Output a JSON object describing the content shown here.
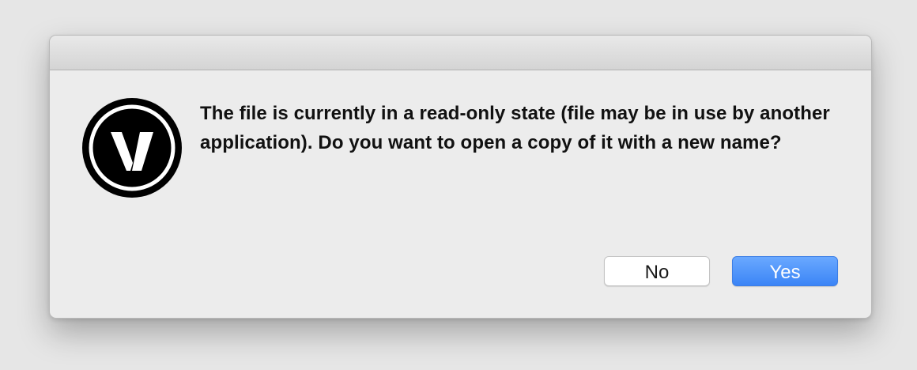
{
  "dialog": {
    "icon": "vectorworks-app-icon",
    "message": "The file is currently in a read-only state (file may be in use by another application). Do you want to open a copy of it with a new name?",
    "buttons": {
      "no_label": "No",
      "yes_label": "Yes"
    }
  },
  "colors": {
    "background": "#e6e6e6",
    "dialog_background": "#ececec",
    "primary_button": "#3b84f6",
    "secondary_button": "#ffffff",
    "text": "#111111"
  }
}
